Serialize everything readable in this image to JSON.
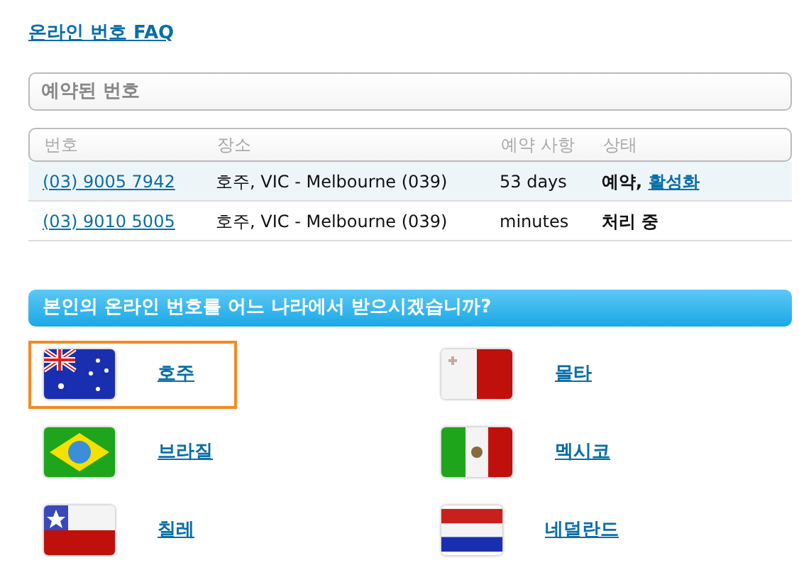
{
  "faq_link": "온라인 번호 FAQ",
  "reserved_title": "예약된 번호",
  "table": {
    "columns": [
      "번호",
      "장소",
      "예약 사항",
      "상태"
    ],
    "rows": [
      {
        "number": "(03) 9005 7942",
        "place": "호주, VIC - Melbourne (039)",
        "reservation": "53 days",
        "status": "예약, ",
        "status_link": "활성화",
        "highlighted": true
      },
      {
        "number": "(03) 9010 5005",
        "place": "호주, VIC - Melbourne (039)",
        "reservation": "minutes",
        "status": "처리 중",
        "highlighted": false
      }
    ]
  },
  "question": "본인의 온라인 번호를 어느 나라에서 받으시겠습니까?",
  "countries": [
    {
      "name": "호주",
      "kind": "au",
      "selected": true
    },
    {
      "name": "몰타",
      "kind": "mt",
      "selected": false
    },
    {
      "name": "브라질",
      "kind": "br",
      "selected": false
    },
    {
      "name": "멕시코",
      "kind": "mx",
      "selected": false
    },
    {
      "name": "칠레",
      "kind": "cl",
      "selected": false
    },
    {
      "name": "네덜란드",
      "kind": "nl",
      "selected": false
    }
  ]
}
